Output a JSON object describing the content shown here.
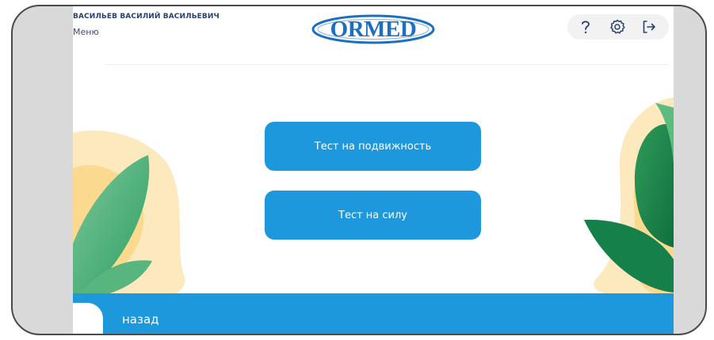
{
  "header": {
    "user_name": "ВАСИЛЬЕВ ВАСИЛИЙ ВАСИЛЬЕВИЧ",
    "menu_label": "Меню",
    "logo_text": "ORMED"
  },
  "toolbar": {
    "help_icon": "question-icon",
    "settings_icon": "gear-icon",
    "logout_icon": "logout-icon"
  },
  "main": {
    "buttons": [
      {
        "label": "Тест на подвижность"
      },
      {
        "label": "Тест на силу"
      }
    ]
  },
  "footer": {
    "back_label": "назад",
    "back_icon": "arrow-left-icon"
  },
  "colors": {
    "accent": "#1e98dc",
    "logo": "#1d6fc0",
    "leaf_green": "#3aa673",
    "blob_yellow": "#fbe2a8"
  }
}
